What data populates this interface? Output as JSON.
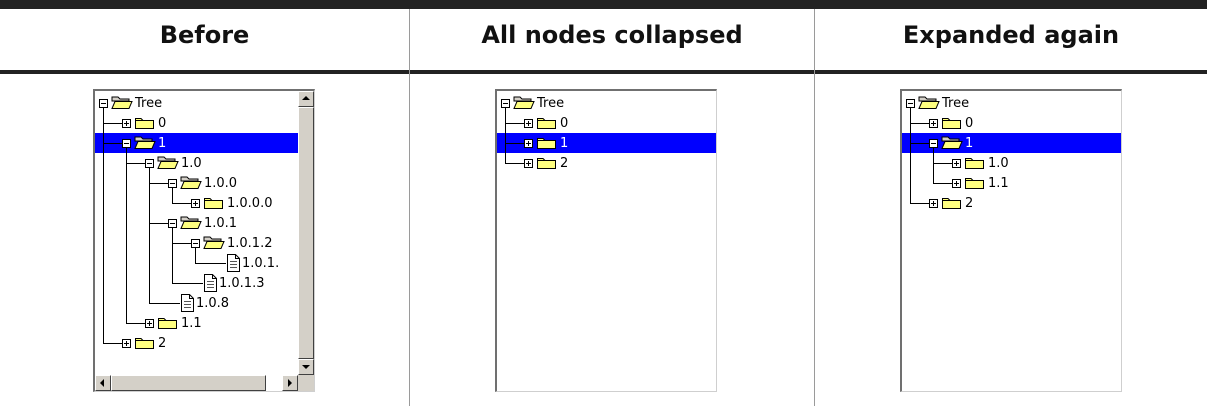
{
  "columns": [
    {
      "header": "Before"
    },
    {
      "header": "All nodes collapsed"
    },
    {
      "header": "Expanded again"
    }
  ],
  "before_tree": {
    "nodes": [
      {
        "label": "Tree",
        "type": "folder",
        "expander": "minus",
        "depth": 0,
        "selected": false
      },
      {
        "label": "0",
        "type": "folder",
        "expander": "plus",
        "depth": 1,
        "selected": false
      },
      {
        "label": "1",
        "type": "folder",
        "expander": "minus",
        "depth": 1,
        "selected": true
      },
      {
        "label": "1.0",
        "type": "folder",
        "expander": "minus",
        "depth": 2,
        "selected": false
      },
      {
        "label": "1.0.0",
        "type": "folder",
        "expander": "minus",
        "depth": 3,
        "selected": false
      },
      {
        "label": "1.0.0.0",
        "type": "folder",
        "expander": "plus",
        "depth": 4,
        "selected": false
      },
      {
        "label": "1.0.1",
        "type": "folder",
        "expander": "minus",
        "depth": 3,
        "selected": false
      },
      {
        "label": "1.0.1.2",
        "type": "folder",
        "expander": "minus",
        "depth": 4,
        "selected": false
      },
      {
        "label": "1.0.1.",
        "type": "leaf",
        "depth": 5,
        "selected": false
      },
      {
        "label": "1.0.1.3",
        "type": "leaf",
        "depth": 4,
        "selected": false
      },
      {
        "label": "1.0.8",
        "type": "leaf",
        "depth": 3,
        "selected": false
      },
      {
        "label": "1.1",
        "type": "folder",
        "expander": "plus",
        "depth": 2,
        "selected": false
      },
      {
        "label": "2",
        "type": "folder",
        "expander": "plus",
        "depth": 1,
        "selected": false
      }
    ]
  },
  "collapsed_tree": {
    "nodes": [
      {
        "label": "Tree",
        "type": "folder",
        "expander": "minus",
        "depth": 0,
        "selected": false
      },
      {
        "label": "0",
        "type": "folder",
        "expander": "plus",
        "depth": 1,
        "selected": false
      },
      {
        "label": "1",
        "type": "folder",
        "expander": "plus",
        "depth": 1,
        "selected": true
      },
      {
        "label": "2",
        "type": "folder",
        "expander": "plus",
        "depth": 1,
        "selected": false
      }
    ]
  },
  "expanded_tree": {
    "nodes": [
      {
        "label": "Tree",
        "type": "folder",
        "expander": "minus",
        "depth": 0,
        "selected": false
      },
      {
        "label": "0",
        "type": "folder",
        "expander": "plus",
        "depth": 1,
        "selected": false
      },
      {
        "label": "1",
        "type": "folder",
        "expander": "minus",
        "depth": 1,
        "selected": true
      },
      {
        "label": "1.0",
        "type": "folder",
        "expander": "plus",
        "depth": 2,
        "selected": false
      },
      {
        "label": "1.1",
        "type": "folder",
        "expander": "plus",
        "depth": 2,
        "selected": false
      },
      {
        "label": "2",
        "type": "folder",
        "expander": "plus",
        "depth": 1,
        "selected": false
      }
    ]
  },
  "colors": {
    "selection": "#0000ff",
    "folder_fill": "#ffff80",
    "scrollbar_face": "#d4d0c8"
  },
  "icons": [
    "expand-box-icon",
    "collapse-box-icon",
    "closed-folder-icon",
    "open-folder-icon",
    "document-icon",
    "scroll-up-arrow-icon",
    "scroll-down-arrow-icon",
    "scroll-left-arrow-icon",
    "scroll-right-arrow-icon"
  ]
}
